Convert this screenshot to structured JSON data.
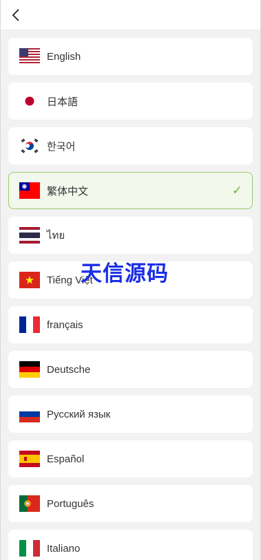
{
  "header": {
    "back_icon": "chevron-left-icon"
  },
  "languages": [
    {
      "label": "English",
      "flag": "flag-us-icon",
      "selected": false
    },
    {
      "label": "日本語",
      "flag": "flag-jp-icon",
      "selected": false
    },
    {
      "label": "한국어",
      "flag": "flag-kr-icon",
      "selected": false
    },
    {
      "label": "繁体中文",
      "flag": "flag-tw-icon",
      "selected": true
    },
    {
      "label": "ไทย",
      "flag": "flag-th-icon",
      "selected": false
    },
    {
      "label": "Tiếng Việt",
      "flag": "flag-vn-icon",
      "selected": false
    },
    {
      "label": "français",
      "flag": "flag-fr-icon",
      "selected": false
    },
    {
      "label": "Deutsche",
      "flag": "flag-de-icon",
      "selected": false
    },
    {
      "label": "Русский язык",
      "flag": "flag-ru-icon",
      "selected": false
    },
    {
      "label": "Español",
      "flag": "flag-es-icon",
      "selected": false
    },
    {
      "label": "Português",
      "flag": "flag-pt-icon",
      "selected": false
    },
    {
      "label": "Italiano",
      "flag": "flag-it-icon",
      "selected": false
    }
  ],
  "selected_check": "✓",
  "watermark": "天信源码",
  "colors": {
    "accent": "#7ab536",
    "selected_bg": "#f2f8ec",
    "selected_border": "#9acb6a",
    "watermark": "#1a2ee6"
  }
}
